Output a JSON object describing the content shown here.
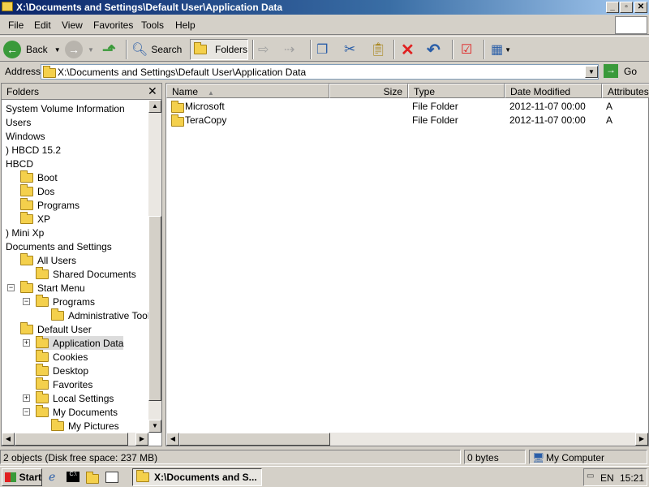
{
  "window": {
    "title": "X:\\Documents and Settings\\Default User\\Application Data"
  },
  "menu": [
    "File",
    "Edit",
    "View",
    "Favorites",
    "Tools",
    "Help"
  ],
  "toolbar": {
    "back_label": "Back",
    "search_label": "Search",
    "folders_label": "Folders"
  },
  "address": {
    "label": "Address",
    "value": "X:\\Documents and Settings\\Default User\\Application Data",
    "go_label": "Go"
  },
  "folders_pane": {
    "title": "Folders",
    "items": [
      {
        "label": "System Volume Information",
        "expander": ""
      },
      {
        "label": "Users",
        "expander": ""
      },
      {
        "label": "Windows",
        "expander": ""
      },
      {
        "label": ") HBCD 15.2",
        "expander": ""
      },
      {
        "label": "HBCD",
        "expander": ""
      },
      {
        "label": "Boot",
        "expander": ""
      },
      {
        "label": "Dos",
        "expander": ""
      },
      {
        "label": "Programs",
        "expander": ""
      },
      {
        "label": "XP",
        "expander": ""
      },
      {
        "label": ") Mini Xp",
        "expander": ""
      },
      {
        "label": "Documents and Settings",
        "expander": ""
      },
      {
        "label": "All Users",
        "expander": ""
      },
      {
        "label": "Shared Documents",
        "expander": ""
      },
      {
        "label": "Start Menu",
        "expander": "−"
      },
      {
        "label": "Programs",
        "expander": "−"
      },
      {
        "label": "Administrative Tools",
        "expander": ""
      },
      {
        "label": "Default User",
        "expander": ""
      },
      {
        "label": "Application Data",
        "expander": "+"
      },
      {
        "label": "Cookies",
        "expander": ""
      },
      {
        "label": "Desktop",
        "expander": ""
      },
      {
        "label": "Favorites",
        "expander": ""
      },
      {
        "label": "Local Settings",
        "expander": "+"
      },
      {
        "label": "My Documents",
        "expander": "−"
      },
      {
        "label": "My Pictures",
        "expander": ""
      }
    ]
  },
  "file_list": {
    "columns": [
      "Name",
      "Size",
      "Type",
      "Date Modified",
      "Attributes"
    ],
    "rows": [
      {
        "name": "Microsoft",
        "size": "",
        "type": "File Folder",
        "date": "2012-11-07 00:00",
        "attr": "A"
      },
      {
        "name": "TeraCopy",
        "size": "",
        "type": "File Folder",
        "date": "2012-11-07 00:00",
        "attr": "A"
      }
    ]
  },
  "status": {
    "objects": "2 objects (Disk free space: 237 MB)",
    "size": "0 bytes",
    "zone": "My Computer"
  },
  "taskbar": {
    "start_label": "Start",
    "window_label": "X:\\Documents and S...",
    "lang": "EN",
    "clock": "15:21"
  },
  "colors": {
    "title_start": "#0a246a",
    "title_end": "#a6caf0",
    "selection": "#dcdcdc",
    "folder": "#f4d04c"
  }
}
